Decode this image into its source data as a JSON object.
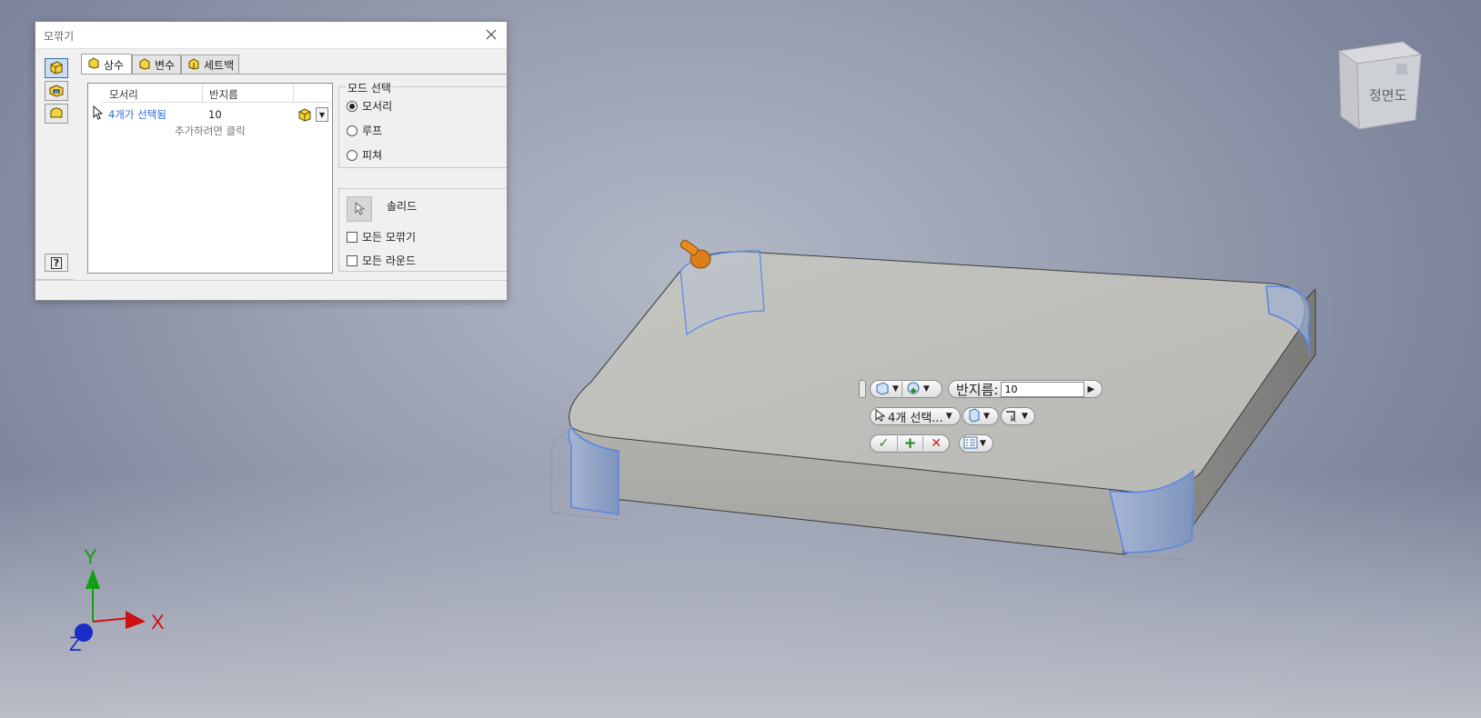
{
  "dialog": {
    "title": "모깎기",
    "tabs": [
      {
        "label": "상수",
        "active": true
      },
      {
        "label": "변수",
        "active": false
      },
      {
        "label": "세트백",
        "active": false
      }
    ],
    "table": {
      "headers": [
        "모서리",
        "반지름"
      ],
      "rows": [
        {
          "edges": "4개가 선택됨",
          "radius": "10"
        }
      ],
      "add_hint": "추가하려면 클릭"
    },
    "mode_group": {
      "title": "모드 선택",
      "options": [
        {
          "label": "모서리",
          "selected": true
        },
        {
          "label": "루프",
          "selected": false
        },
        {
          "label": "피쳐",
          "selected": false
        }
      ]
    },
    "solid": {
      "label": "솔리드",
      "checkboxes": [
        {
          "label": "모든 모깎기",
          "checked": false
        },
        {
          "label": "모든 라운드",
          "checked": false
        }
      ]
    }
  },
  "mini_toolbar": {
    "radius_label": "반지름:",
    "radius_value": "10",
    "selection_label": "4개 선택..."
  },
  "view_cube": {
    "face_label": "정면도"
  },
  "axes": {
    "x": "X",
    "y": "Y",
    "z": "Z"
  },
  "colors": {
    "accent": "#3a6ea5",
    "link": "#2a6bd6",
    "ok": "#1e8a1e",
    "cancel": "#cc1d1d",
    "axis_x": "#d01010",
    "axis_y": "#12a012",
    "axis_z": "#1a2dc8"
  }
}
